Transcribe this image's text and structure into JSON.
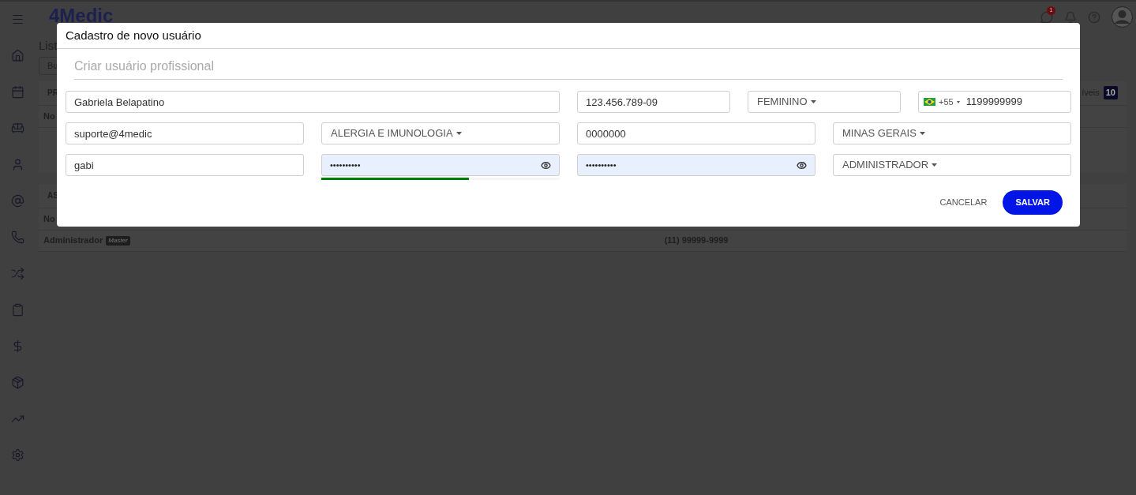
{
  "app": {
    "logo": "4Medic",
    "notification_count": "1"
  },
  "background_page": {
    "heading": "List",
    "search_placeholder": "Bu",
    "section_1_header": "PR",
    "badge_label": "íveis",
    "badge_count": "10",
    "section_1_column": "No",
    "section_2_header": "AS",
    "section_2_column": "No",
    "row": {
      "role": "Administrador",
      "tag": "Master",
      "phone": "(11) 99999-9999"
    }
  },
  "dialog": {
    "title": "Cadastro de novo usuário",
    "section_title": "Criar usuário profissional",
    "fields": [
      {
        "kind": "text",
        "value": "Gabriela Belapatino"
      },
      {
        "kind": "text",
        "value": "123.456.789-09"
      },
      {
        "kind": "select",
        "value": "FEMININO"
      },
      {
        "kind": "phone",
        "country_code": "+55",
        "value": "1199999999"
      },
      {
        "kind": "text",
        "value": "suporte@4medic"
      },
      {
        "kind": "select",
        "value": "ALERGIA E IMUNOLOGIA"
      },
      {
        "kind": "text",
        "value": "0000000"
      },
      {
        "kind": "select",
        "value": "MINAS GERAIS"
      },
      {
        "kind": "text",
        "value": "gabi"
      },
      {
        "kind": "password",
        "value": "••••••••••",
        "level": 0.62
      },
      {
        "kind": "password",
        "value": "••••••••••"
      },
      {
        "kind": "select",
        "value": "ADMINISTRADOR"
      }
    ],
    "buttons": [
      {
        "label": "CANCELAR",
        "kind": "flat"
      },
      {
        "label": "SALVAR",
        "kind": "primary"
      }
    ]
  }
}
